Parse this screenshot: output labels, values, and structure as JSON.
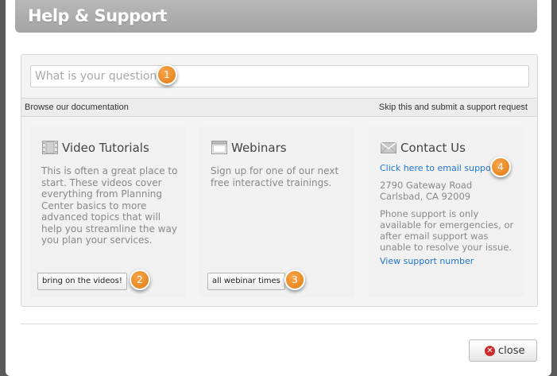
{
  "header": {
    "title": "Help & Support"
  },
  "search": {
    "placeholder": "What is your question?",
    "value": ""
  },
  "bar": {
    "browse_label": "Browse our documentation",
    "skip_label": "Skip this and submit a support request"
  },
  "cards": {
    "video": {
      "icon": "film-icon",
      "title": "Video Tutorials",
      "description": "This is often a great place to start. These videos cover everything from Planning Center basics to more advanced topics that will help you streamline the way you plan your services.",
      "button_label": "bring on the videos!"
    },
    "webinars": {
      "icon": "window-icon",
      "title": "Webinars",
      "description": "Sign up for one of our next free interactive trainings.",
      "button_label": "all webinar times"
    },
    "contact": {
      "icon": "envelope-icon",
      "title": "Contact Us",
      "email_link": "Click here to email support",
      "address_line1": "2790 Gateway Road",
      "address_line2": "Carlsbad, CA 92009",
      "phone_note": "Phone support is only available for emergencies, or after email support was unable to resolve your issue.",
      "phone_link": "View support number"
    }
  },
  "badges": [
    "1",
    "2",
    "3",
    "4"
  ],
  "footer": {
    "close_label": "close",
    "close_icon": "close-icon"
  },
  "colors": {
    "header": "#a9a9a9",
    "link": "#1f75cc",
    "badge": "#ec8a1f",
    "close_icon": "#cc2b2b"
  }
}
